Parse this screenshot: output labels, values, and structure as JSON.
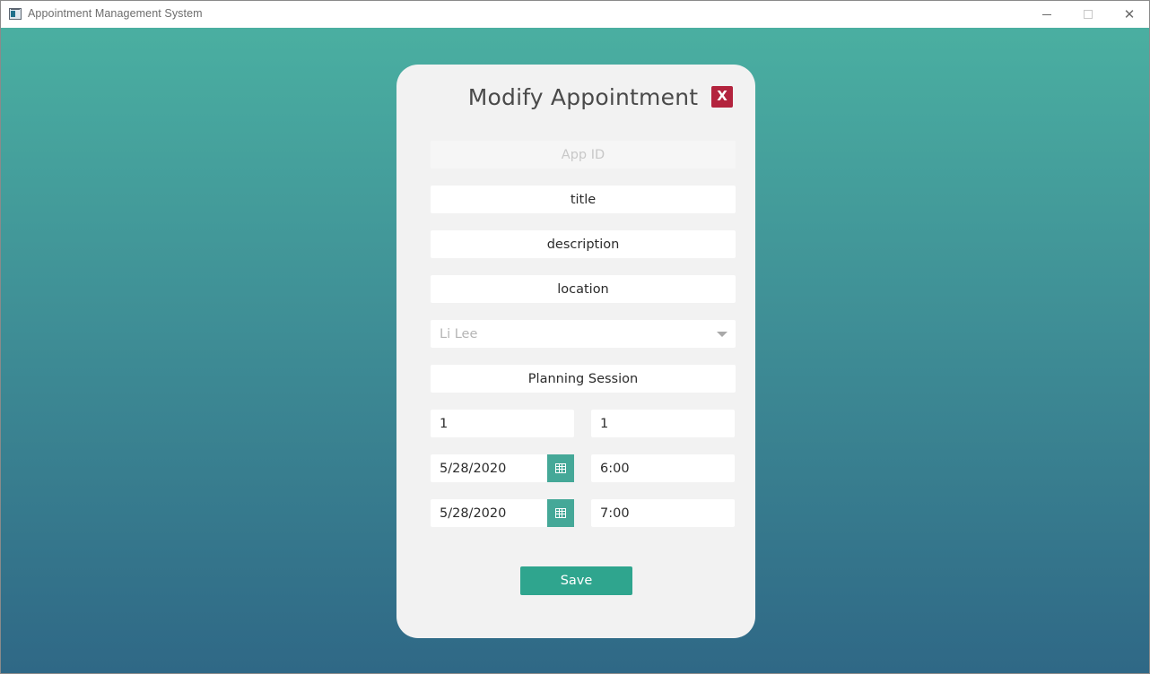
{
  "window": {
    "title": "Appointment Management System",
    "icon": "app-window-icon",
    "controls": {
      "minimize": "minimize-icon",
      "maximize": "maximize-icon",
      "close": "✕"
    }
  },
  "colors": {
    "background_top": "#4aafa1",
    "background_bottom": "#2f6886",
    "dialog": "#f2f2f2",
    "close_button": "#b3243e",
    "accent": "#45a898",
    "save_button": "#2fa58e"
  },
  "dialog": {
    "title": "Modify Appointment",
    "close_label": "X",
    "fields": {
      "app_id": {
        "placeholder": "App ID",
        "value": ""
      },
      "title": "title",
      "description": "description",
      "location": "location",
      "contact": "Li Lee",
      "type": "Planning Session",
      "customer_id": "1",
      "user_id": "1",
      "start_date": "5/28/2020",
      "start_time": "6:00",
      "end_date": "5/28/2020",
      "end_time": "7:00"
    },
    "save_label": "Save"
  }
}
